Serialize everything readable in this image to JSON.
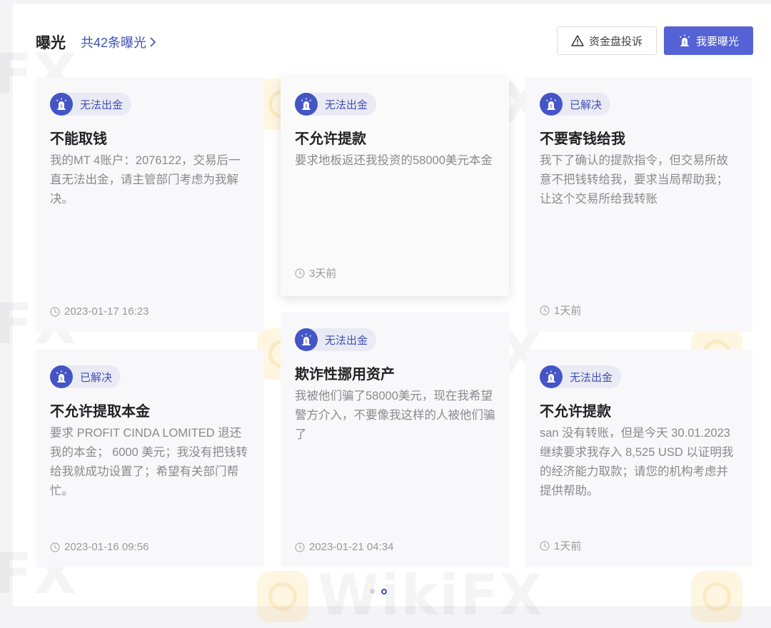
{
  "header": {
    "title": "曝光",
    "count_link": "共42条曝光",
    "complaint_button": "资金盘投诉",
    "expose_button": "我要曝光"
  },
  "watermark": {
    "text": "WikiFX",
    "edge_text": "FX"
  },
  "cards": [
    {
      "tag": "无法出金",
      "title": "不能取钱",
      "description": "我的MT 4账户：2076122，交易后一直无法出金，请主管部门考虑为我解决。",
      "time": "2023-01-17 16:23"
    },
    {
      "tag": "无法出金",
      "title": "不允许提款",
      "description": "要求地板返还我投资的58000美元本金",
      "time": "3天前"
    },
    {
      "tag": "已解决",
      "title": "不要寄钱给我",
      "description": "我下了确认的提款指令，但交易所故意不把钱转给我，要求当局帮助我；让这个交易所给我转账",
      "time": "1天前"
    },
    {
      "tag": "已解决",
      "title": "不允许提取本金",
      "description": "要求 PROFIT CINDA LOMITED 退还我的本金； 6000 美元；我没有把钱转给我就成功设置了；希望有关部门帮忙。",
      "time": "2023-01-16 09:56"
    },
    {
      "tag": "无法出金",
      "title": "欺诈性挪用资产",
      "description": "我被他们骗了58000美元，现在我希望警方介入，不要像我这样的人被他们骗了",
      "time": "2023-01-21 04:34"
    },
    {
      "tag": "无法出金",
      "title": "不允许提款",
      "description": "san 没有转账，但是今天 30.01.2023 继续要求我存入 8,525 USD 以证明我的经济能力取款；请您的机构考虑并提供帮助。",
      "time": "1天前"
    }
  ],
  "pagination": {
    "total": 2,
    "active": 2
  },
  "colors": {
    "accent": "#5562d6",
    "link": "#4050b5",
    "badge_bg": "#e9eaf4"
  }
}
